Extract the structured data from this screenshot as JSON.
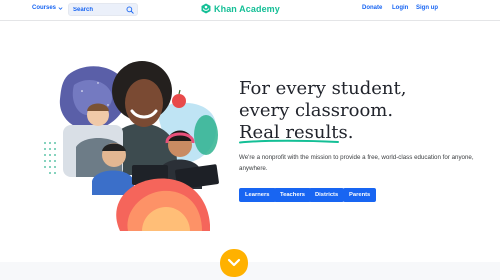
{
  "header": {
    "courses_label": "Courses",
    "search_placeholder": "Search",
    "logo_text": "Khan Academy",
    "donate_label": "Donate",
    "login_label": "Login",
    "signup_label": "Sign up"
  },
  "hero": {
    "headline_line1": "For every student,",
    "headline_line2": "every classroom.",
    "headline_line3": "Real results.",
    "subtext": "We're a nonprofit with the mission to provide a free, world-class education for anyone, anywhere.",
    "buttons": [
      "Learners",
      "Teachers",
      "Districts",
      "Parents"
    ]
  },
  "colors": {
    "brand_blue": "#1865f2",
    "brand_green": "#14bf96",
    "accent_orange": "#ffb100"
  },
  "icons": {
    "search": "search-icon",
    "courses_dropdown": "chevron-down-icon",
    "scroll_down": "chevron-down-icon"
  }
}
